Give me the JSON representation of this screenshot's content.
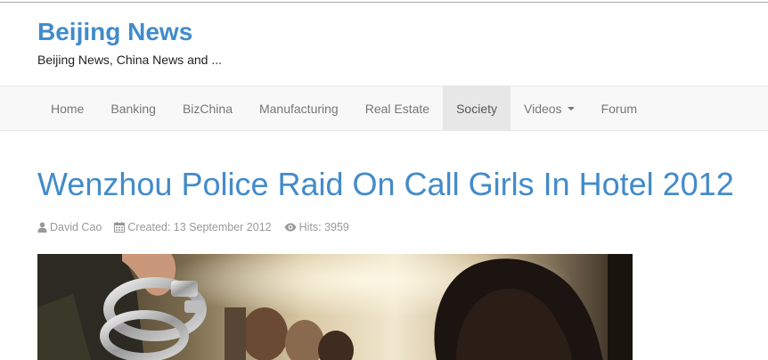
{
  "site": {
    "title": "Beijing News",
    "tagline": "Beijing News, China News and ..."
  },
  "nav": {
    "items": [
      {
        "label": "Home",
        "active": false
      },
      {
        "label": "Banking",
        "active": false
      },
      {
        "label": "BizChina",
        "active": false
      },
      {
        "label": "Manufacturing",
        "active": false
      },
      {
        "label": "Real Estate",
        "active": false
      },
      {
        "label": "Society",
        "active": true
      },
      {
        "label": "Videos",
        "active": false,
        "dropdown": true
      },
      {
        "label": "Forum",
        "active": false
      }
    ]
  },
  "article": {
    "title": "Wenzhou Police Raid On Call Girls In Hotel 2012",
    "author": "David Cao",
    "created": "Created: 13 September 2012",
    "hits": "Hits: 3959",
    "image_icon": "article-photo"
  },
  "icons": {
    "author": "user-icon",
    "created": "calendar-icon",
    "hits": "eye-icon",
    "dropdown": "caret-down-icon"
  },
  "colors": {
    "link": "#428bca",
    "nav_bg": "#f8f8f8",
    "nav_active_bg": "#e7e7e7",
    "meta_text": "#999999"
  }
}
